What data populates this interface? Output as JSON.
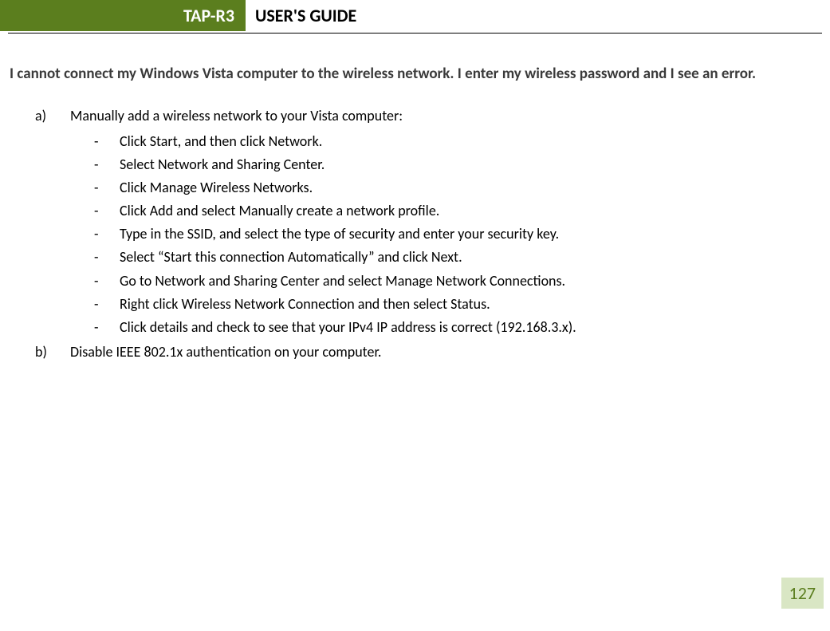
{
  "header": {
    "product": "TAP-R3",
    "title": "USER'S GUIDE"
  },
  "question": "I cannot connect my Windows Vista computer to the wireless network.  I enter my wireless password and I see an error.",
  "items": [
    {
      "marker": "a)",
      "text": "Manually add a wireless network to your Vista computer:",
      "sub": [
        "Click Start, and then click Network.",
        "Select Network and Sharing Center.",
        "Click Manage Wireless Networks.",
        "Click Add and select Manually create a network profile.",
        "Type in the SSID, and select the type of security and enter your security key.",
        "Select “Start this connection Automatically” and click Next.",
        "Go to Network and Sharing Center and select Manage Network Connections.",
        "Right click Wireless Network Connection and then select Status.",
        "Click details and check to see that your IPv4 IP address is correct (192.168.3.x)."
      ]
    },
    {
      "marker": "b)",
      "text": "Disable IEEE 802.1x authentication on your computer.",
      "sub": []
    }
  ],
  "page_number": "127"
}
